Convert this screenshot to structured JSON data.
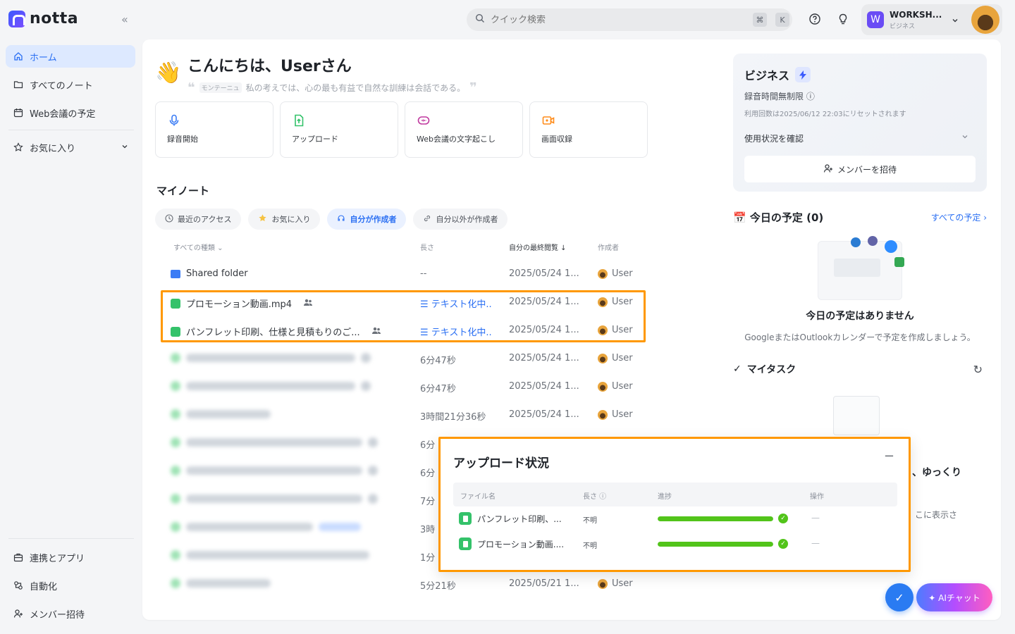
{
  "app": {
    "name": "notta",
    "collapse_glyph": "«"
  },
  "sidebar": {
    "items": [
      {
        "label": "ホーム",
        "icon": "home-icon",
        "active": true
      },
      {
        "label": "すべてのノート",
        "icon": "folder-icon"
      },
      {
        "label": "Web会議の予定",
        "icon": "calendar-icon"
      }
    ],
    "favorites": {
      "label": "お気に入り",
      "icon": "star-icon"
    },
    "bottom": [
      {
        "label": "連携とアプリ",
        "icon": "apps-icon"
      },
      {
        "label": "自動化",
        "icon": "automation-icon"
      },
      {
        "label": "メンバー招待",
        "icon": "add-member-icon"
      }
    ]
  },
  "topbar": {
    "search_placeholder": "クイック検索",
    "kbd1": "⌘",
    "kbd2": "K",
    "workspace": {
      "badge": "W",
      "name": "WORKSH...",
      "plan": "ビジネス"
    }
  },
  "greeting": {
    "emoji": "👋",
    "title": "こんにちは、Userさん",
    "quote_author": "モンテーニュ",
    "quote": "私の考えでは、心の最も有益で自然な訓練は会話である。",
    "open_quote": "❝",
    "close_quote": "❞"
  },
  "actions": [
    {
      "label": "録音開始",
      "icon": "mic-icon",
      "color": "#3b7cf5"
    },
    {
      "label": "アップロード",
      "icon": "upload-icon",
      "color": "#34c26a"
    },
    {
      "label": "Web会議の文字起こし",
      "icon": "meeting-icon",
      "color": "#c0399f"
    },
    {
      "label": "画面収録",
      "icon": "screen-record-icon",
      "color": "#ff8c1a"
    }
  ],
  "notes": {
    "title": "マイノート",
    "filters": [
      {
        "label": "最近のアクセス",
        "icon": "clock-icon"
      },
      {
        "label": "お気に入り",
        "icon": "star-icon"
      },
      {
        "label": "自分が作成者",
        "icon": "headset-icon",
        "active": true
      },
      {
        "label": "自分以外が作成者",
        "icon": "link-icon"
      }
    ],
    "columns": {
      "type": "すべての種類 ⌄",
      "length": "長さ",
      "last_viewed": "自分の最終閲覧 ↓",
      "author": "作成者"
    },
    "rows": [
      {
        "name": "Shared folder",
        "kind": "folder",
        "length": "--",
        "date": "2025/05/24 1...",
        "author": "User"
      },
      {
        "name": "プロモーション動画.mp4",
        "kind": "file",
        "shared": true,
        "length": "☰ テキスト化中..",
        "length_link": true,
        "date": "2025/05/24 1...",
        "author": "User"
      },
      {
        "name": "パンフレット印刷、仕様と見積もりのご...",
        "kind": "file",
        "shared": true,
        "length": "☰ テキスト化中..",
        "length_link": true,
        "date": "2025/05/24 1...",
        "author": "User"
      },
      {
        "blurred": true,
        "length": "6分47秒",
        "date": "2025/05/24 1...",
        "author": "User"
      },
      {
        "blurred": true,
        "length": "6分47秒",
        "date": "2025/05/24 1...",
        "author": "User"
      },
      {
        "blurred": true,
        "length": "3時間21分36秒",
        "date": "2025/05/24 1...",
        "author": "User"
      },
      {
        "blurred": true,
        "length": "6分",
        "date": "",
        "author": ""
      },
      {
        "blurred": true,
        "length": "6分",
        "date": "",
        "author": ""
      },
      {
        "blurred": true,
        "length": "7分",
        "date": "",
        "author": ""
      },
      {
        "blurred": true,
        "length": "3時",
        "date": "",
        "author": ""
      },
      {
        "blurred": true,
        "length": "1分",
        "date": "",
        "author": ""
      },
      {
        "blurred": true,
        "length": "5分21秒",
        "date": "2025/05/21 1...",
        "author": "User"
      }
    ]
  },
  "business": {
    "title": "ビジネス",
    "line1": "録音時間無制限 ⓘ",
    "line2": "利用回数は2025/06/12 22:03にリセットされます",
    "usage": "使用状況を確認",
    "invite": "メンバーを招待"
  },
  "today": {
    "title": "📅 今日の予定 (0)",
    "link": "すべての予定 ›",
    "empty_title": "今日の予定はありません",
    "empty_sub": "GoogleまたはOutlookカレンダーで予定を作成しましょう。"
  },
  "tasks": {
    "title": "マイタスク",
    "check": "✓",
    "refresh": "↻",
    "partial1": "、ゆっくり",
    "partial2": "こに表示さ"
  },
  "upload": {
    "title": "アップロード状況",
    "minimize": "−",
    "columns": {
      "name": "ファイル名",
      "length": "長さ ⓘ",
      "progress": "進捗",
      "ops": "操作"
    },
    "rows": [
      {
        "name": "パンフレット印刷、...",
        "length": "不明",
        "progress": 1.0,
        "op": "—"
      },
      {
        "name": "プロモーション動画....",
        "length": "不明",
        "progress": 1.0,
        "op": "—"
      }
    ]
  },
  "fab": {
    "check": "✓",
    "ai": "✦ AIチャット"
  }
}
